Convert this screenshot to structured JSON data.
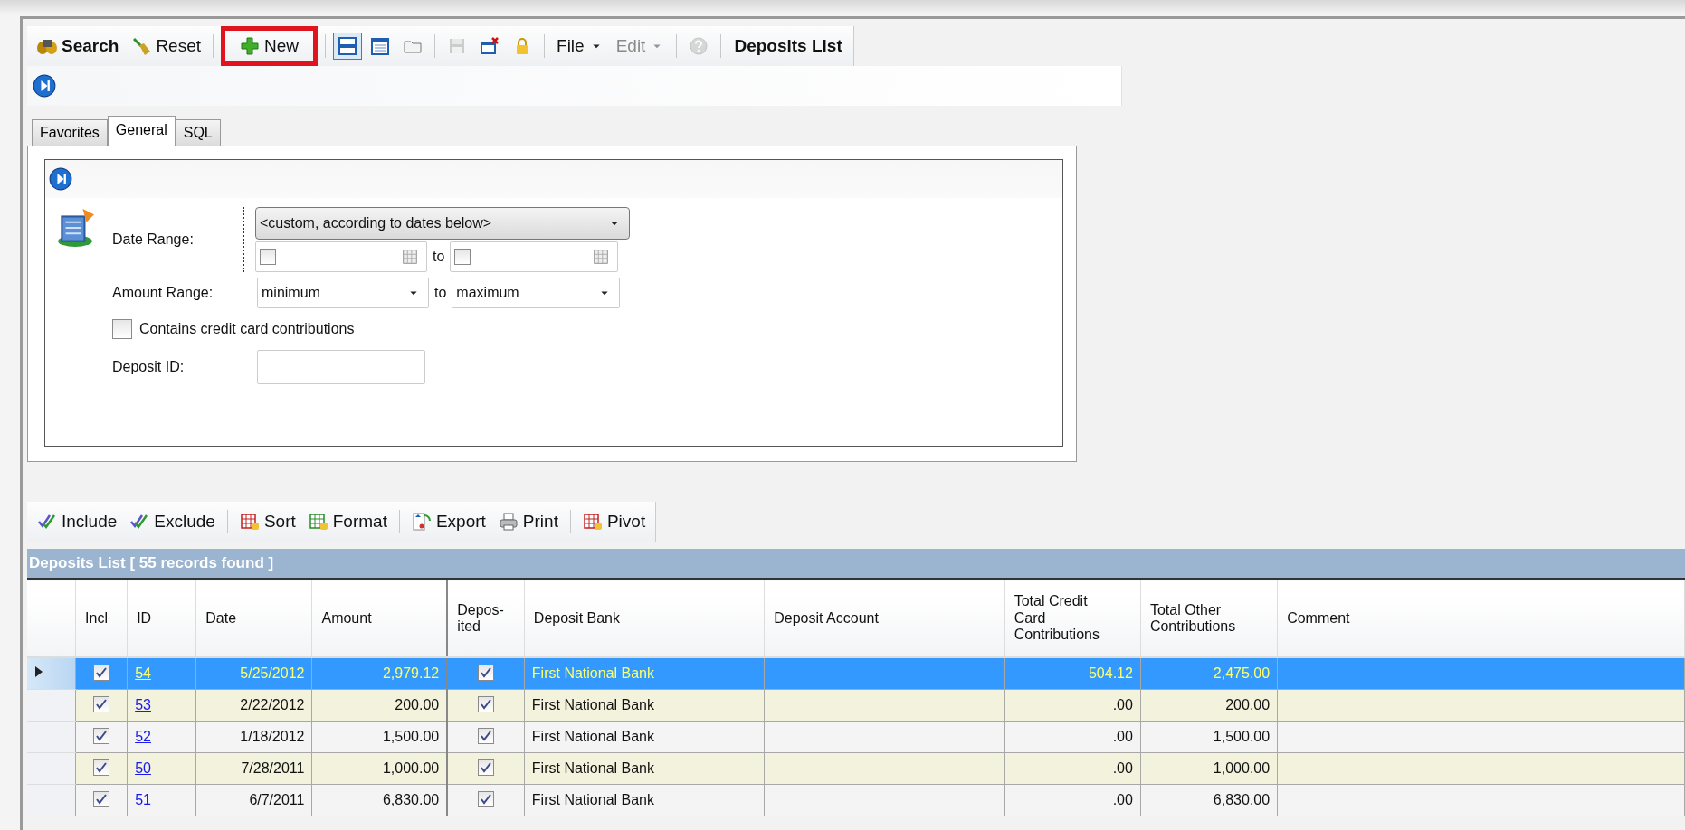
{
  "toolbar": [
    {
      "kind": "button",
      "label": "Search",
      "bold": true
    },
    {
      "kind": "button",
      "label": "Reset"
    },
    {
      "kind": "separator"
    },
    {
      "kind": "button",
      "label": "New",
      "highlighted": true
    },
    {
      "kind": "separator"
    },
    {
      "kind": "icon",
      "selected": true
    },
    {
      "kind": "icon"
    },
    {
      "kind": "icon"
    },
    {
      "kind": "separator"
    },
    {
      "kind": "icon",
      "disabled": true
    },
    {
      "kind": "icon"
    },
    {
      "kind": "icon"
    },
    {
      "kind": "separator"
    },
    {
      "kind": "menu",
      "label": "File"
    },
    {
      "kind": "menu",
      "label": "Edit",
      "disabled": true
    },
    {
      "kind": "separator"
    },
    {
      "kind": "icon",
      "disabled": true
    },
    {
      "kind": "separator"
    },
    {
      "kind": "title",
      "label": "Deposits List"
    }
  ],
  "tabs": [
    {
      "label": "Favorites",
      "selected": false
    },
    {
      "label": "General",
      "selected": true
    },
    {
      "label": "SQL",
      "selected": false
    }
  ],
  "filter": {
    "date_range": {
      "label": "Date Range:",
      "value": "<custom, according to dates below>",
      "from_checked": false,
      "to": "to",
      "to_checked": false
    },
    "amount_range": {
      "label": "Amount Range:",
      "min": "minimum",
      "to": "to",
      "max": "maximum"
    },
    "credit_card": {
      "label": "Contains credit card contributions",
      "checked": false
    },
    "deposit_id": {
      "label": "Deposit ID:"
    }
  },
  "grid_toolbar": [
    {
      "kind": "button",
      "label": "Include"
    },
    {
      "kind": "button",
      "label": "Exclude"
    },
    {
      "kind": "separator"
    },
    {
      "kind": "button",
      "label": "Sort"
    },
    {
      "kind": "button",
      "label": "Format"
    },
    {
      "kind": "separator"
    },
    {
      "kind": "button",
      "label": "Export"
    },
    {
      "kind": "button",
      "label": "Print"
    },
    {
      "kind": "separator"
    },
    {
      "kind": "button",
      "label": "Pivot"
    }
  ],
  "grid": {
    "title": "Deposits List [ 55 records found ]",
    "columns": [
      "Incl",
      "ID",
      "Date",
      "Amount",
      "Depos-ited",
      "Deposit Bank",
      "Deposit Account",
      "Total Credit Card Contributions",
      "Total Other Contributions",
      "Comment"
    ],
    "rows": [
      {
        "selected": true,
        "incl": true,
        "id": "54",
        "date": "5/25/2012",
        "amount": "2,979.12",
        "deposited": true,
        "bank": "First National Bank",
        "credit_card": "504.12",
        "other": "2,475.00"
      },
      {
        "selected": false,
        "incl": true,
        "id": "53",
        "date": "2/22/2012",
        "amount": "200.00",
        "deposited": true,
        "bank": "First National Bank",
        "credit_card": ".00",
        "other": "200.00"
      },
      {
        "selected": false,
        "incl": true,
        "id": "52",
        "date": "1/18/2012",
        "amount": "1,500.00",
        "deposited": true,
        "bank": "First National Bank",
        "credit_card": ".00",
        "other": "1,500.00"
      },
      {
        "selected": false,
        "incl": true,
        "id": "50",
        "date": "7/28/2011",
        "amount": "1,000.00",
        "deposited": true,
        "bank": "First National Bank",
        "credit_card": ".00",
        "other": "1,000.00"
      },
      {
        "selected": false,
        "incl": true,
        "id": "51",
        "date": "6/7/2011",
        "amount": "6,830.00",
        "deposited": true,
        "bank": "First National Bank",
        "credit_card": ".00",
        "other": "6,830.00"
      }
    ]
  }
}
